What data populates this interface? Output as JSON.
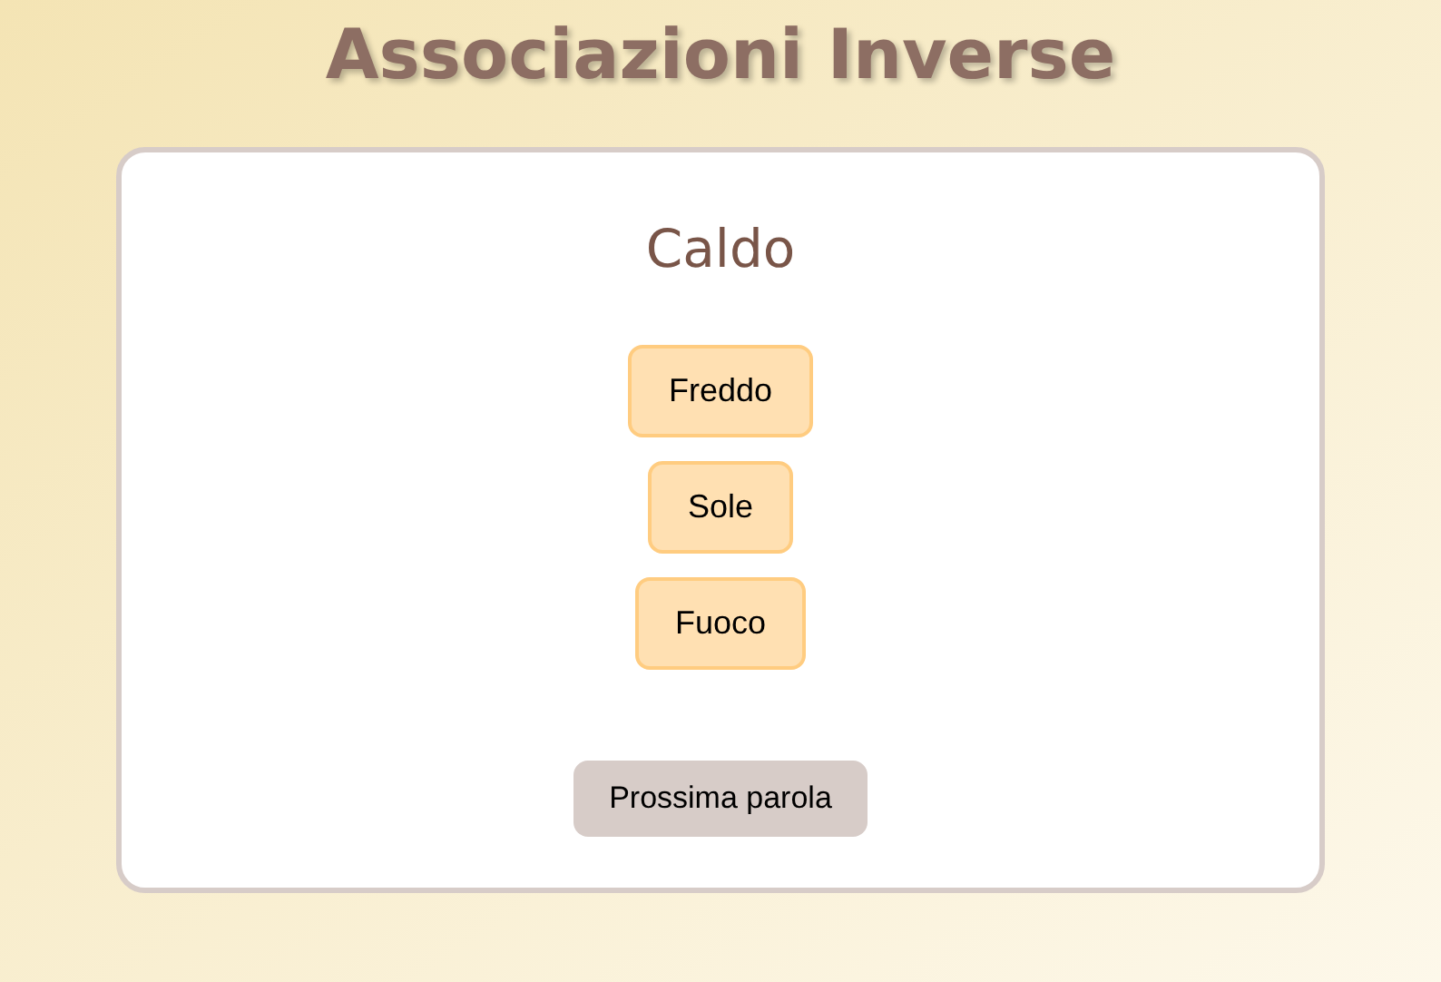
{
  "title": "Associazioni Inverse",
  "word": "Caldo",
  "options": [
    {
      "label": "Freddo"
    },
    {
      "label": "Sole"
    },
    {
      "label": "Fuoco"
    }
  ],
  "next_button": "Prossima parola"
}
